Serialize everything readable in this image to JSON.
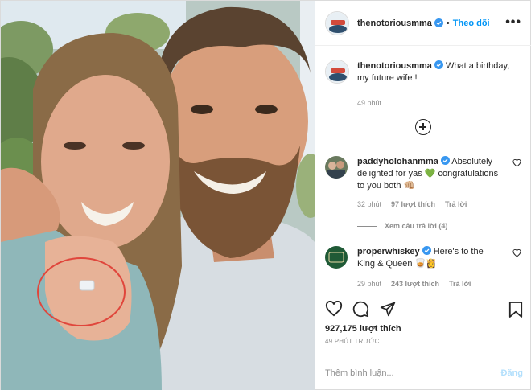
{
  "account": {
    "username": "thenotoriousmma",
    "verified": true,
    "dot": "•",
    "follow_label": "Theo dõi",
    "more_label": "•••"
  },
  "caption": {
    "username": "thenotoriousmma",
    "text": "What a birthday, my future wife !",
    "time": "49 phút"
  },
  "comments": [
    {
      "username": "paddyholohanmma",
      "text": "Absolutely delighted for yas 💚 congratulations to you both 👊🏼",
      "time": "32 phút",
      "likes": "97 lượt thích",
      "reply": "Trả lời",
      "view_replies": "Xem câu trả lời (4)"
    },
    {
      "username": "properwhiskey",
      "text": "Here's to the King & Queen 🥃👸",
      "time": "29 phút",
      "likes": "243 lượt thích",
      "reply": "Trả lời",
      "avatar_text": "PROPER TWELVE"
    }
  ],
  "stats": {
    "likes": "927,175 lượt thích",
    "posted_ago": "49 PHÚT TRƯỚC"
  },
  "add_comment": {
    "placeholder": "Thêm bình luận...",
    "post_label": "Đăng"
  },
  "icons": [
    "heart-icon",
    "comment-icon",
    "share-icon",
    "bookmark-icon",
    "add-comment-circle-icon",
    "verified-badge-icon",
    "more-options-icon"
  ],
  "colors": {
    "link_blue": "#0095f6",
    "muted": "#8e8e8e",
    "verified": "#3897f0",
    "ring_red": "#e0463c"
  }
}
